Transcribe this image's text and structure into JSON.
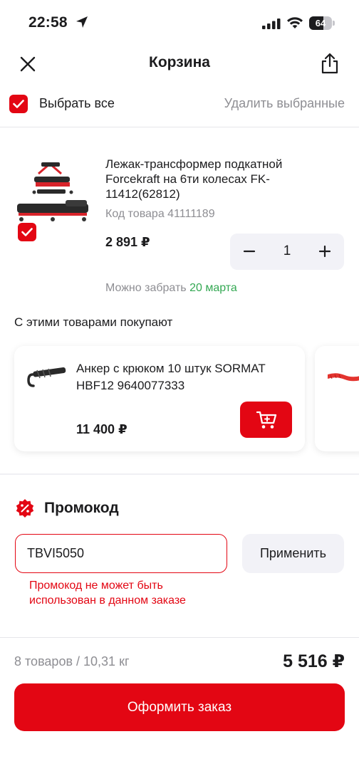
{
  "status_bar": {
    "time": "22:58",
    "battery_percent": 64,
    "battery_label": "64",
    "icons": [
      "location-arrow-icon",
      "cellular-signal-icon",
      "wifi-icon",
      "battery-icon"
    ]
  },
  "header": {
    "title": "Корзина",
    "close_icon": "close-icon",
    "share_icon": "share-icon"
  },
  "selection": {
    "select_all_label": "Выбрать все",
    "select_all_checked": true,
    "delete_selected_label": "Удалить выбранные"
  },
  "cart_item": {
    "name": "Лежак-трансформер подкатной Forcekraft на 6ти колесах FK-11412(62812)",
    "code": "Код товара 41111189",
    "price": "2 891 ₽",
    "quantity": "1",
    "checked": true,
    "pickup_label": "Можно забрать",
    "pickup_date": "20 марта"
  },
  "recommendations": {
    "title": "С этими товарами покупают",
    "items": [
      {
        "name": "Анкер с крюком 10 штук SORMAT HBF12 9640077333",
        "price": "11 400 ₽",
        "cart_icon": "cart-icon"
      }
    ]
  },
  "promo": {
    "title": "Промокод",
    "icon": "percent-badge-icon",
    "code_value": "TBVI5050",
    "apply_label": "Применить",
    "error": "Промокод не может быть использован в данном заказе"
  },
  "summary": {
    "count_weight": "8 товаров / 10,31 кг",
    "total": "5 516 ₽",
    "checkout_label": "Оформить заказ"
  },
  "colors": {
    "accent": "#e30613",
    "pickup_green": "#34a853",
    "muted_text": "#8e8e93",
    "stepper_bg": "#f2f2f7"
  }
}
